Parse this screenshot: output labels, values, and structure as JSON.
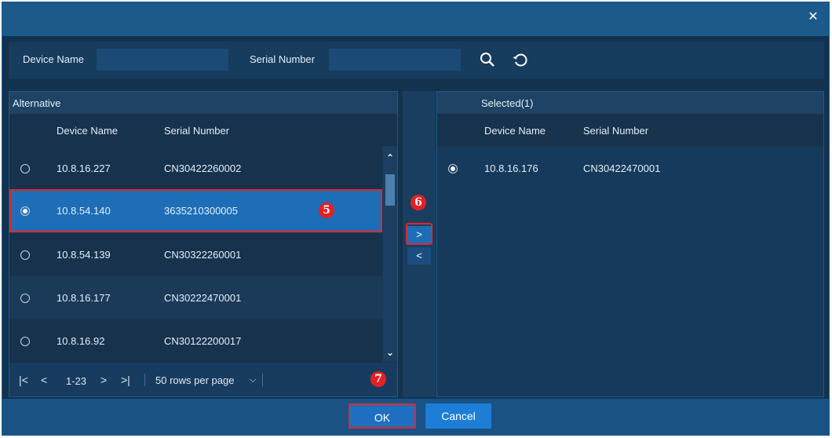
{
  "dialog": {
    "close_icon": "close-icon"
  },
  "search": {
    "device_name_label": "Device Name",
    "device_name_value": "",
    "serial_number_label": "Serial Number",
    "serial_number_value": ""
  },
  "alternative": {
    "title": "Alternative",
    "col_device": "Device Name",
    "col_serial": "Serial Number",
    "rows": [
      {
        "device": "10.8.16.227",
        "serial": "CN30422260002",
        "selected": false
      },
      {
        "device": "10.8.54.140",
        "serial": "3635210300005",
        "selected": true
      },
      {
        "device": "10.8.54.139",
        "serial": "CN30322260001",
        "selected": false
      },
      {
        "device": "10.8.16.177",
        "serial": "CN30222470001",
        "selected": false
      },
      {
        "device": "10.8.16.92",
        "serial": "CN30122200017",
        "selected": false
      }
    ],
    "pager": {
      "first": "|<",
      "prev": "<",
      "range": "1-23",
      "next": ">",
      "last": ">|",
      "rows_per_page": "50 rows per page"
    }
  },
  "selected": {
    "title": "Selected(1)",
    "col_device": "Device Name",
    "col_serial": "Serial Number",
    "rows": [
      {
        "device": "10.8.16.176",
        "serial": "CN30422470001",
        "selected": true
      }
    ]
  },
  "transfer": {
    "add": ">",
    "remove": "<"
  },
  "annotations": {
    "step5": "5",
    "step6": "6",
    "step7": "7"
  },
  "footer": {
    "ok": "OK",
    "cancel": "Cancel"
  },
  "colors": {
    "accent": "#1d6eb7",
    "highlight": "#e2272b",
    "background": "#12324e"
  }
}
